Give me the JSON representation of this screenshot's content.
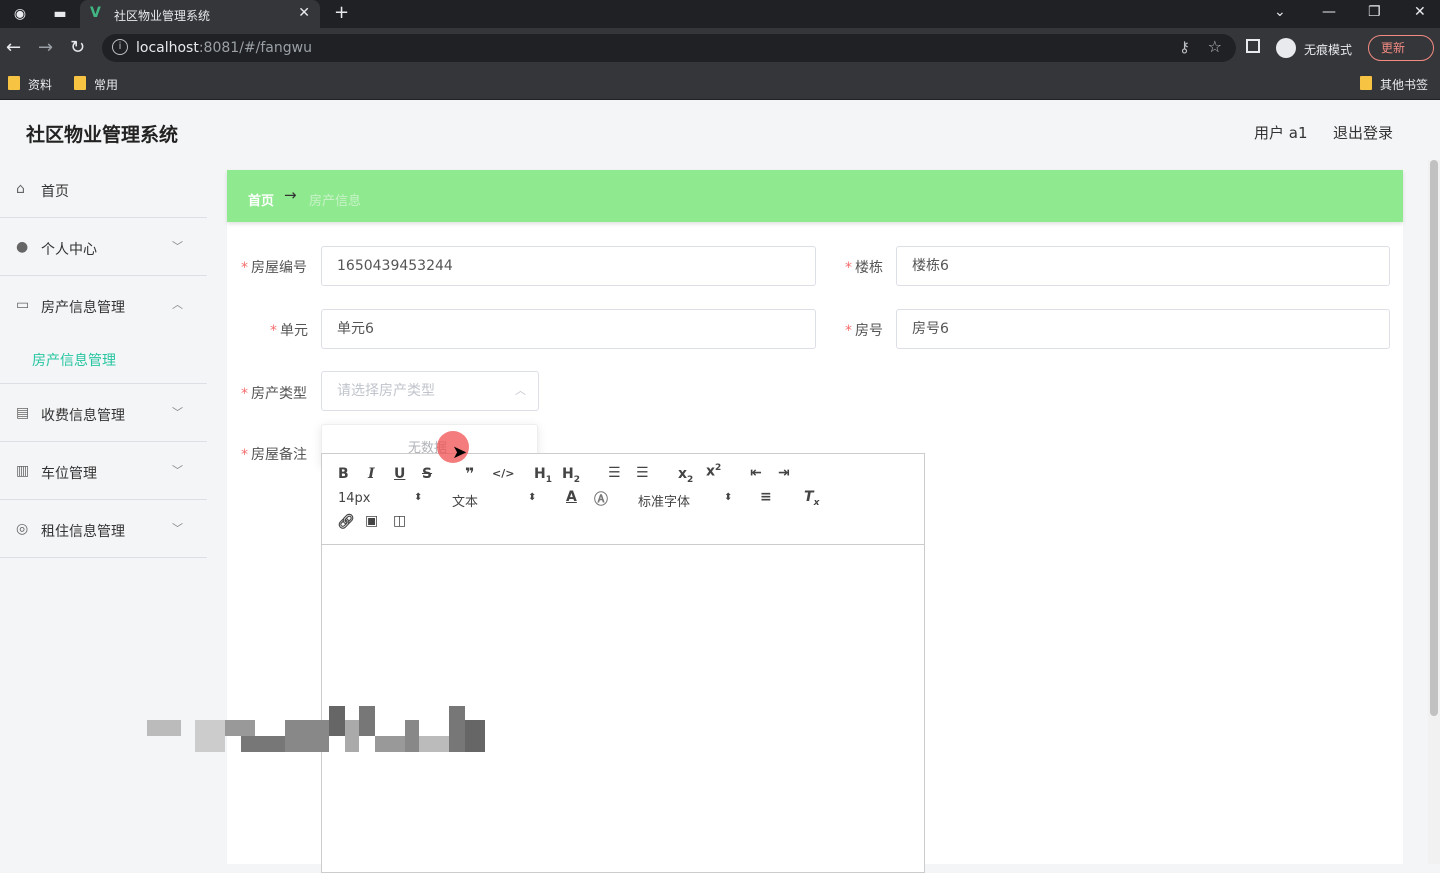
{
  "browser": {
    "tab_title": "社区物业管理系统",
    "url_host": "localhost",
    "url_rest": ":8081/#/fangwu",
    "incognito_label": "无痕模式",
    "update_label": "更新",
    "bookmarks": [
      "资料",
      "常用"
    ],
    "other_bookmarks": "其他书签"
  },
  "header": {
    "brand": "社区物业管理系统",
    "user": "用户 a1",
    "logout": "退出登录"
  },
  "sidebar": {
    "items": [
      {
        "label": "首页",
        "icon": "home-icon"
      },
      {
        "label": "个人中心",
        "icon": "user-icon"
      },
      {
        "label": "房产信息管理",
        "icon": "monitor-icon"
      },
      {
        "label": "收费信息管理",
        "icon": "briefcase-icon"
      },
      {
        "label": "车位管理",
        "icon": "clipboard-icon"
      },
      {
        "label": "租住信息管理",
        "icon": "circle-icon"
      }
    ],
    "submenu_active": "房产信息管理"
  },
  "breadcrumb": {
    "home": "首页",
    "current": "房产信息"
  },
  "form": {
    "house_no_label": "房屋编号",
    "house_no_value": "1650439453244",
    "building_label": "楼栋",
    "building_value": "楼栋6",
    "unit_label": "单元",
    "unit_value": "单元6",
    "room_label": "房号",
    "room_value": "房号6",
    "type_label": "房产类型",
    "type_placeholder": "请选择房产类型",
    "type_dropdown_empty": "无数据",
    "remark_label": "房屋备注"
  },
  "editor_toolbar": {
    "font_size": "14px",
    "header_select": "文本",
    "font_family": "标准字体"
  },
  "colors": {
    "breadcrumb_bg": "#8fea8f",
    "active_submenu": "#26c6a0",
    "required_star": "#f56c6c"
  }
}
